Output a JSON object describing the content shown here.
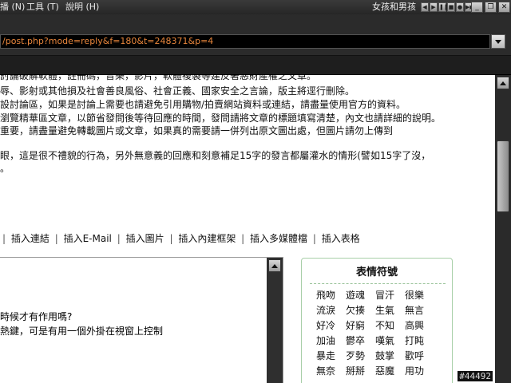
{
  "menubar": {
    "items": [
      "播 (N)",
      "工具 (T)",
      "說明 (H)"
    ],
    "player_title": "女孩和男孩",
    "media_buttons": [
      "◀",
      "▶",
      "❚❚",
      "■",
      "●",
      "▶▶"
    ],
    "window_buttons": [
      "_",
      "❐",
      "✕"
    ]
  },
  "address": {
    "url": "/post.php?mode=reply&f=180&t=248371&p=4"
  },
  "rules": [
    "討論破解軟體，註冊碼，音樂，影片，軟體複製等建反著惡財產權之文章。",
    "辱、影射或其他損及社會善良風俗、社會正義、國家安全之言論，版主將逕行刪除。",
    "設討論區，如果是討論上需要也請避免引用購物/拍賣網站資料或連結，請盡量使用官方的資料。",
    "瀏覽精華區文章，以節省發問後等待回應的時間，發問請將文章的標題填寫清楚，內文也請詳細的說明。",
    "重要，請盡量避免轉載圖片或文章，如果真的需要請一併列出原文圖出處，但圖片請勿上傳到",
    "眼，這是很不禮貌的行為，另外無意義的回應和刻意補足15字的發言都屬灌水的情形(譬如15字了沒，",
    "。"
  ],
  "toolbar": {
    "items": [
      "插入連結",
      "插入E-Mail",
      "插入圖片",
      "插入內建框架",
      "插入多媒體檔",
      "插入表格"
    ]
  },
  "editor": {
    "lines": [
      "時候才有作用嗎?",
      "熱鍵，可是有用一個外掛在視窗上控制"
    ]
  },
  "emoticons": {
    "title": "表情符號",
    "items": [
      "飛吻",
      "遊魂",
      "冒汗",
      "很樂",
      "流淚",
      "欠揍",
      "生氣",
      "無言",
      "好冷",
      "好窮",
      "不知",
      "高興",
      "加油",
      "鬱卒",
      "嘆氣",
      "打盹",
      "暴走",
      "歹勢",
      "鼓掌",
      "歡呼",
      "無奈",
      "掰掰",
      "惡魔",
      "用功"
    ]
  },
  "watermark": "#44492"
}
